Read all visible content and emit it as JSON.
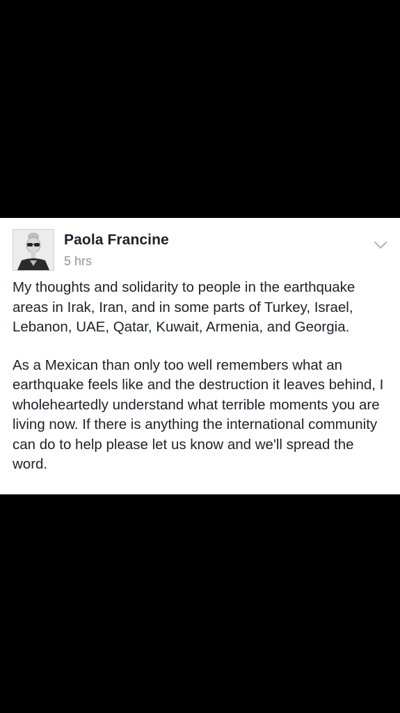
{
  "post": {
    "author": "Paola Francine",
    "time": "5 hrs",
    "avatar_icon": "profile-photo-woman-sunglasses",
    "menu_icon": "chevron-down-icon",
    "paragraphs": [
      "My thoughts and solidarity to people in the earthquake areas in Irak, Iran, and in some parts of Turkey, Israel, Lebanon, UAE, Qatar, Kuwait, Armenia, and Georgia.",
      "As a Mexican than only too well remembers what an earthquake feels like and the destruction it leaves behind, I wholeheartedly understand what terrible moments you are living now. If there is anything the international community can do to help please let us know and we'll spread the word."
    ]
  },
  "colors": {
    "background": "#000000",
    "card": "#ffffff",
    "text": "#1d2129",
    "muted": "#90949c"
  }
}
